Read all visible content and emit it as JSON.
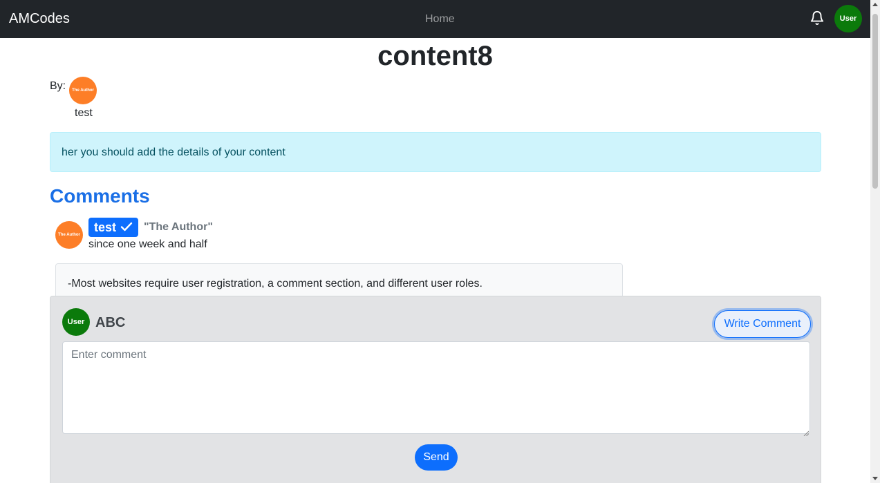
{
  "navbar": {
    "brand": "AMCodes",
    "home_link": "Home",
    "user_avatar_text": "User"
  },
  "post": {
    "title": "content8",
    "by_label": "By:",
    "author_avatar_text": "The Author",
    "author_name": "test",
    "details": "her you should add the details of your content"
  },
  "comments": {
    "heading": "Comments",
    "items": [
      {
        "avatar_text": "The Author",
        "username": "test",
        "role": "\"The Author\"",
        "time": "since one week and half",
        "body": "-Most websites require user registration, a comment section, and different user roles."
      }
    ]
  },
  "write_comment": {
    "avatar_text": "User",
    "name": "ABC",
    "button_label": "Write Comment",
    "placeholder": "Enter comment",
    "send_label": "Send"
  },
  "colors": {
    "navbar_bg": "#212529",
    "primary": "#0d6efd",
    "info_bg": "#cff4fc",
    "author_avatar": "#fd7e27",
    "user_avatar": "#0b7a0b",
    "panel_bg": "#e2e3e5"
  },
  "icons": {
    "notifications": "bell-icon",
    "verified": "check-icon"
  }
}
